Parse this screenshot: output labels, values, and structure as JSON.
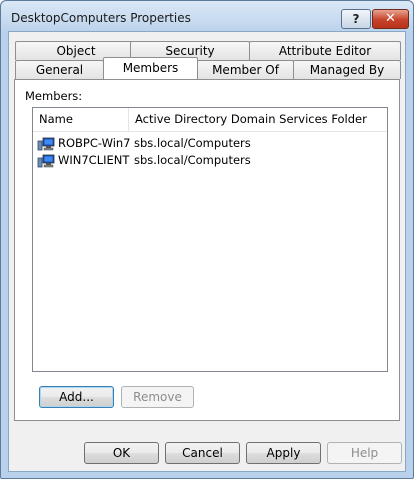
{
  "window": {
    "title": "DesktopComputers Properties",
    "help_label": "?",
    "close_label": "✕"
  },
  "tabs": {
    "back": [
      "Object",
      "Security",
      "Attribute Editor"
    ],
    "front": [
      "General",
      "Members",
      "Member Of",
      "Managed By"
    ],
    "active": "Members"
  },
  "members": {
    "label": "Members:",
    "columns": [
      "Name",
      "Active Directory Domain Services Folder"
    ],
    "rows": [
      {
        "name": "ROBPC-Win7",
        "folder": "sbs.local/Computers",
        "icon": "computer-icon"
      },
      {
        "name": "WIN7CLIENT",
        "folder": "sbs.local/Computers",
        "icon": "computer-icon"
      }
    ],
    "add_label": "Add...",
    "remove_label": "Remove"
  },
  "footer": {
    "ok_label": "OK",
    "cancel_label": "Cancel",
    "apply_label": "Apply",
    "help_label": "Help"
  }
}
